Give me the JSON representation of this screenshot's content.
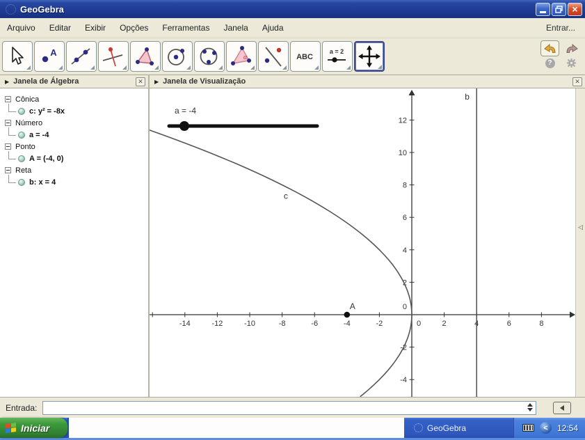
{
  "window": {
    "title": "GeoGebra",
    "controls": [
      "minimize",
      "restore",
      "close"
    ]
  },
  "menu": {
    "items": [
      "Arquivo",
      "Editar",
      "Exibir",
      "Opções",
      "Ferramentas",
      "Janela",
      "Ajuda"
    ],
    "signin": "Entrar..."
  },
  "toolbar": {
    "tools": [
      {
        "name": "move",
        "icon": "cursor-icon",
        "selected": false
      },
      {
        "name": "point",
        "icon": "point-icon",
        "selected": false
      },
      {
        "name": "line",
        "icon": "line-icon",
        "selected": false
      },
      {
        "name": "special-line",
        "icon": "perpendicular-icon",
        "selected": false
      },
      {
        "name": "polygon",
        "icon": "polygon-icon",
        "selected": false
      },
      {
        "name": "circle",
        "icon": "circle-icon",
        "selected": false
      },
      {
        "name": "conic",
        "icon": "conic-icon",
        "selected": false
      },
      {
        "name": "angle",
        "icon": "angle-icon",
        "selected": false
      },
      {
        "name": "transform",
        "icon": "reflect-icon",
        "selected": false
      },
      {
        "name": "text",
        "icon": "text-icon",
        "label": "ABC",
        "selected": false
      },
      {
        "name": "slider",
        "icon": "slider-icon",
        "label": "a = 2",
        "selected": false
      },
      {
        "name": "move-view",
        "icon": "move-view-icon",
        "selected": true
      }
    ]
  },
  "algebra": {
    "title": "Janela de Álgebra",
    "groups": [
      {
        "label": "Cônica",
        "items": [
          "c: y² = -8x"
        ]
      },
      {
        "label": "Número",
        "items": [
          "a = -4"
        ]
      },
      {
        "label": "Ponto",
        "items": [
          "A = (-4, 0)"
        ]
      },
      {
        "label": "Reta",
        "items": [
          "b: x = 4"
        ]
      }
    ]
  },
  "viz": {
    "title": "Janela de Visualização"
  },
  "chart_data": {
    "type": "line",
    "title": "",
    "xlabel": "",
    "ylabel": "",
    "xlim": [
      -16.2,
      10.1
    ],
    "ylim": [
      -5.1,
      13.9
    ],
    "grid": false,
    "x_ticks": [
      -16,
      -14,
      -12,
      -10,
      -8,
      -6,
      -4,
      -2,
      2,
      4,
      6,
      8
    ],
    "x_labeled_ticks": [
      -14,
      -12,
      -10,
      -8,
      -6,
      -4,
      -2,
      0,
      2,
      4,
      6,
      8
    ],
    "y_ticks": [
      -4,
      -2,
      2,
      4,
      6,
      8,
      10,
      12
    ],
    "y_labeled_ticks": [
      -4,
      -2,
      0,
      2,
      4,
      6,
      8,
      10,
      12
    ],
    "objects": [
      {
        "kind": "conic",
        "name": "c",
        "equation": "y² = -8x",
        "coef": -8,
        "label_pos": [
          -7.9,
          7.15
        ]
      },
      {
        "kind": "slider",
        "name": "a",
        "label": "a = -4",
        "value": -4
      },
      {
        "kind": "point",
        "name": "A",
        "x": -4,
        "y": 0
      },
      {
        "kind": "line",
        "name": "b",
        "equation": "x = 4",
        "x": 4
      }
    ]
  },
  "input_bar": {
    "label": "Entrada:",
    "value": ""
  },
  "taskbar": {
    "start_label": "Iniciar",
    "task_label": "GeoGebra",
    "clock": "12:54"
  }
}
